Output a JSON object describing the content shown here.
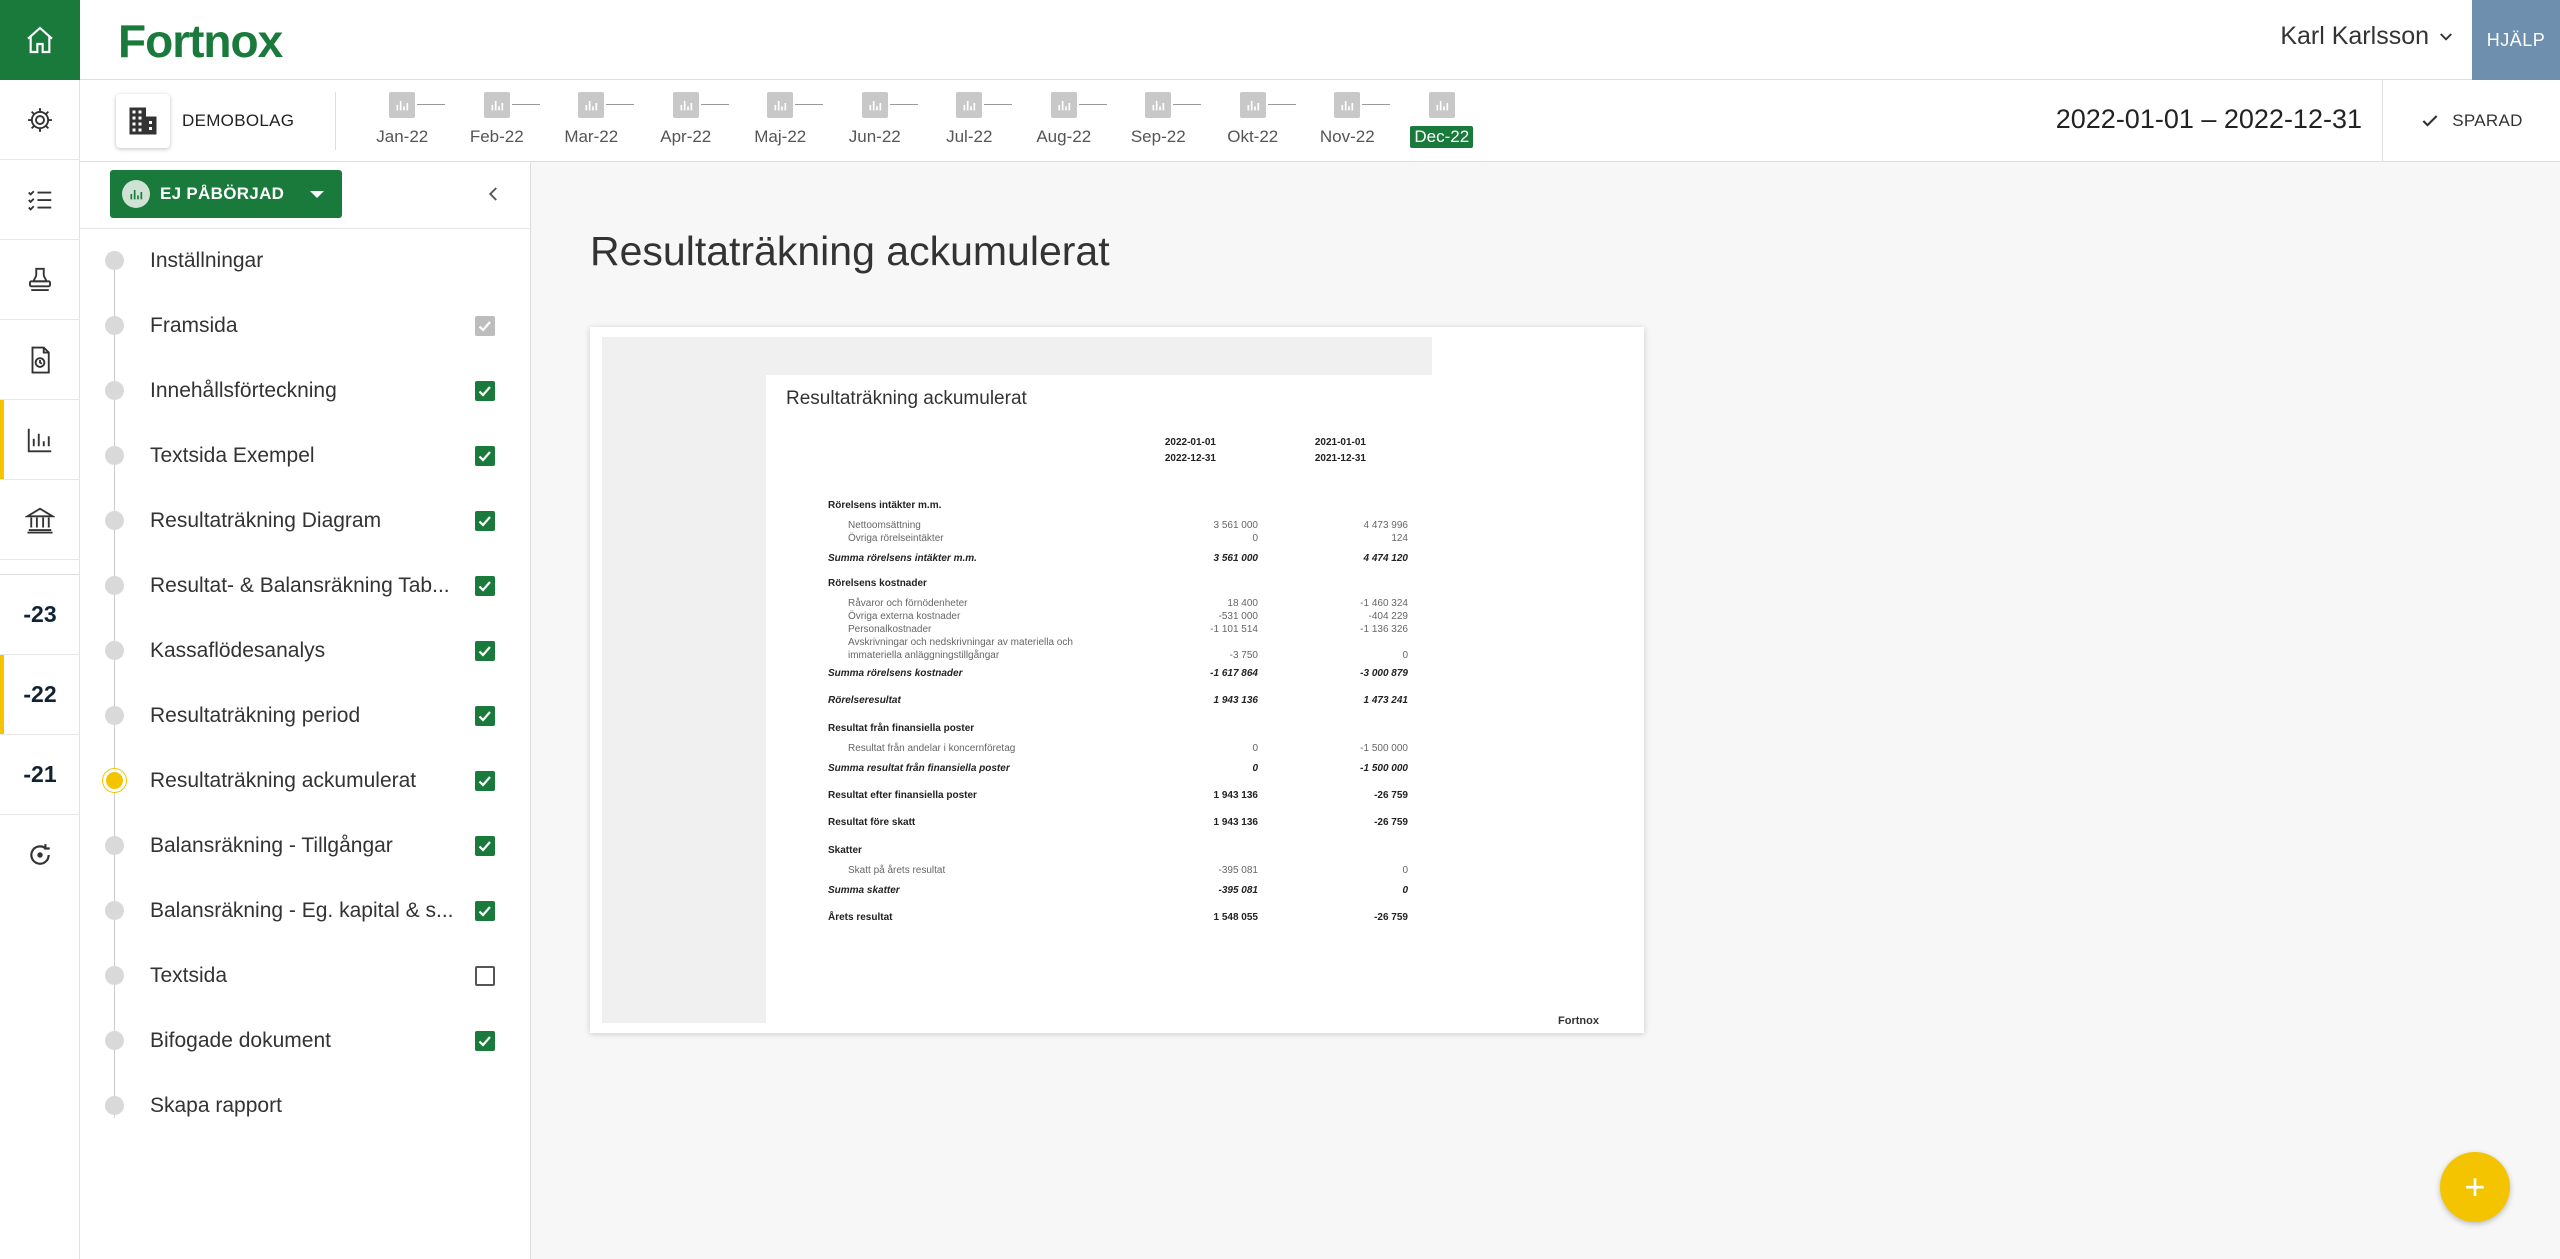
{
  "app": {
    "logo": "Fortnox",
    "help_label": "HJÄLP"
  },
  "user": {
    "name": "Karl Karlsson"
  },
  "company": {
    "name": "DEMOBOLAG"
  },
  "period": {
    "months": [
      "Jan-22",
      "Feb-22",
      "Mar-22",
      "Apr-22",
      "Maj-22",
      "Jun-22",
      "Jul-22",
      "Aug-22",
      "Sep-22",
      "Okt-22",
      "Nov-22",
      "Dec-22"
    ],
    "selected": "Dec-22",
    "date_range": "2022-01-01 – 2022-12-31",
    "saved_label": "SPARAD"
  },
  "rail": {
    "icons": [
      "home-icon",
      "settings-icon",
      "checklist-icon",
      "stamp-icon",
      "document-icon",
      "chart-icon",
      "bank-icon"
    ],
    "years": [
      "-23",
      "-22",
      "-21"
    ],
    "active_year": "-22"
  },
  "sidebar": {
    "status_label": "EJ PÅBÖRJAD",
    "items": [
      {
        "label": "Inställningar",
        "check": "none"
      },
      {
        "label": "Framsida",
        "check": "grey"
      },
      {
        "label": "Innehållsförteckning",
        "check": "on"
      },
      {
        "label": "Textsida Exempel",
        "check": "on"
      },
      {
        "label": "Resultaträkning Diagram",
        "check": "on"
      },
      {
        "label": "Resultat- & Balansräkning Tab...",
        "check": "on"
      },
      {
        "label": "Kassaflödesanalys",
        "check": "on"
      },
      {
        "label": "Resultaträkning period",
        "check": "on"
      },
      {
        "label": "Resultaträkning ackumulerat",
        "check": "on",
        "current": true
      },
      {
        "label": "Balansräkning - Tillgångar",
        "check": "on"
      },
      {
        "label": "Balansräkning - Eg. kapital & s...",
        "check": "on"
      },
      {
        "label": "Textsida",
        "check": "off"
      },
      {
        "label": "Bifogade dokument",
        "check": "on"
      },
      {
        "label": "Skapa rapport",
        "check": "none"
      }
    ]
  },
  "main": {
    "title": "Resultaträkning ackumulerat",
    "document": {
      "title": "Resultaträkning ackumulerat",
      "col1": [
        "2022-01-01",
        "2022-12-31"
      ],
      "col2": [
        "2021-01-01",
        "2021-12-31"
      ],
      "footer": "Fortnox",
      "rows": [
        {
          "type": "head",
          "label": "Rörelsens intäkter m.m.",
          "v1": "",
          "v2": ""
        },
        {
          "type": "sub",
          "label": "Nettoomsättning",
          "v1": "3 561 000",
          "v2": "4 473 996"
        },
        {
          "type": "sub",
          "label": "Övriga rörelseintäkter",
          "v1": "0",
          "v2": "124"
        },
        {
          "type": "sum",
          "label": "Summa rörelsens intäkter m.m.",
          "v1": "3 561 000",
          "v2": "4 474 120"
        },
        {
          "type": "head",
          "label": "Rörelsens kostnader",
          "v1": "",
          "v2": ""
        },
        {
          "type": "sub",
          "label": "Råvaror och förnödenheter",
          "v1": "18 400",
          "v2": "-1 460 324"
        },
        {
          "type": "sub",
          "label": "Övriga externa kostnader",
          "v1": "-531 000",
          "v2": "-404 229"
        },
        {
          "type": "sub",
          "label": "Personalkostnader",
          "v1": "-1 101 514",
          "v2": "-1 136 326"
        },
        {
          "type": "sub",
          "label": "Avskrivningar och nedskrivningar av materiella och",
          "v1": "",
          "v2": ""
        },
        {
          "type": "sub",
          "label": "immateriella anläggningstillgångar",
          "v1": "-3 750",
          "v2": "0"
        },
        {
          "type": "sum",
          "label": "Summa rörelsens kostnader",
          "v1": "-1 617 864",
          "v2": "-3 000 879"
        },
        {
          "type": "sum",
          "label": "Rörelseresultat",
          "v1": "1 943 136",
          "v2": "1 473 241"
        },
        {
          "type": "head",
          "label": "Resultat från finansiella poster",
          "v1": "",
          "v2": ""
        },
        {
          "type": "sub",
          "label": "Resultat från andelar i koncernföretag",
          "v1": "0",
          "v2": "-1 500 000"
        },
        {
          "type": "sum",
          "label": "Summa resultat från finansiella poster",
          "v1": "0",
          "v2": "-1 500 000"
        },
        {
          "type": "total",
          "label": "Resultat efter finansiella poster",
          "v1": "1 943 136",
          "v2": "-26 759"
        },
        {
          "type": "total",
          "label": "Resultat före skatt",
          "v1": "1 943 136",
          "v2": "-26 759"
        },
        {
          "type": "head",
          "label": "Skatter",
          "v1": "",
          "v2": ""
        },
        {
          "type": "sub",
          "label": "Skatt på årets resultat",
          "v1": "-395 081",
          "v2": "0"
        },
        {
          "type": "sum",
          "label": "Summa skatter",
          "v1": "-395 081",
          "v2": "0"
        },
        {
          "type": "total",
          "label": "Årets resultat",
          "v1": "1 548 055",
          "v2": "-26 759"
        }
      ]
    }
  },
  "fab": {
    "label": "+"
  },
  "colors": {
    "brand": "#1a7a3b",
    "accent": "#f5c400",
    "help": "#6e8fae"
  }
}
